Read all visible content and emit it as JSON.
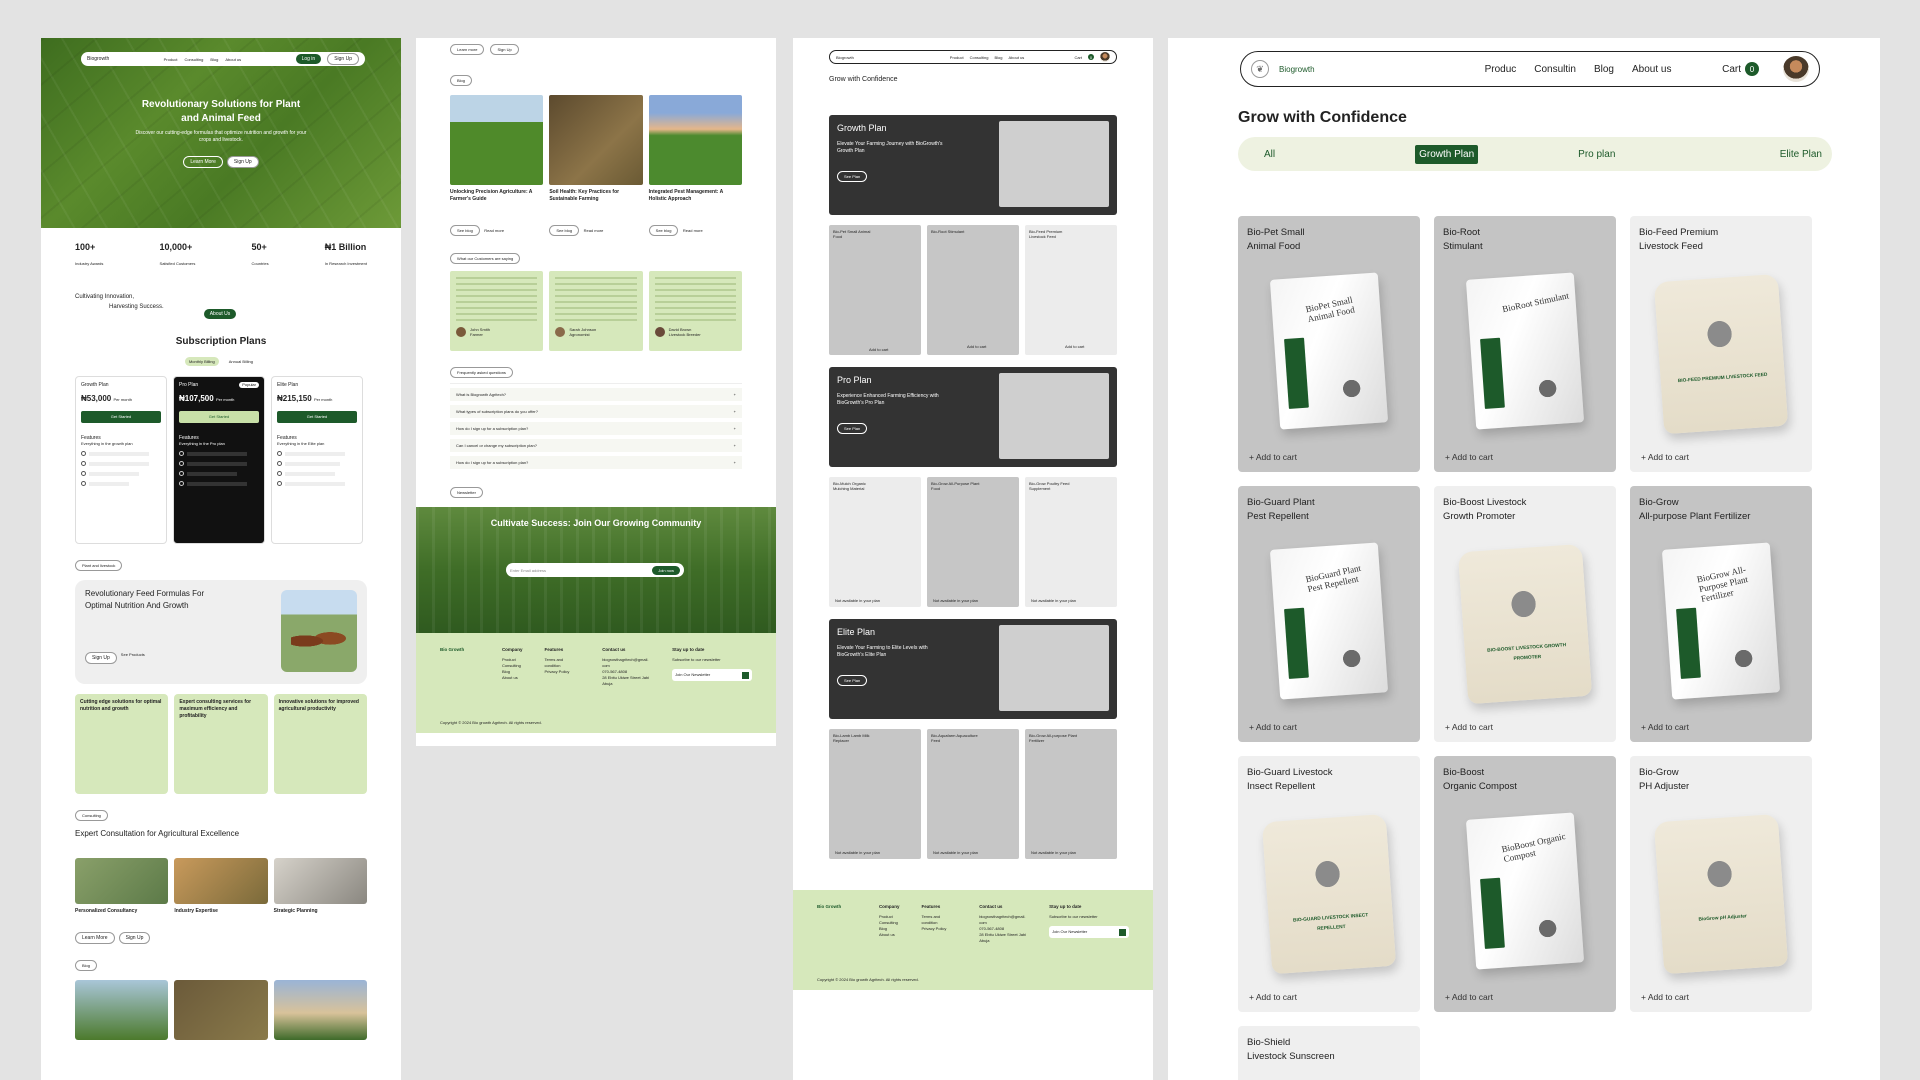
{
  "home": {
    "nav": {
      "logo": "Biogrowth",
      "links": [
        "Product",
        "Consulting",
        "Blog",
        "About us"
      ],
      "login": "Log in",
      "signup": "Sign Up"
    },
    "hero": {
      "title": "Revolutionary Solutions for Plant and Animal Feed",
      "subtitle": "Discover our cutting-edge formulas that optimize nutrition and growth for your crops and livestock.",
      "learn_more": "Learn More",
      "sign_up": "Sign Up"
    },
    "stats": [
      {
        "value": "100+",
        "label": "Industry Awards"
      },
      {
        "value": "10,000+",
        "label": "Satisfied Customers"
      },
      {
        "value": "50+",
        "label": "Countries"
      },
      {
        "value": "₦1 Billion",
        "label": "In Research Investment"
      }
    ],
    "cultivating": {
      "line1": "Cultivating Innovation,",
      "line2": "Harvesting Success.",
      "about": "About Us"
    },
    "subscription": {
      "title": "Subscription Plans",
      "toggle": [
        "Monthly Billing",
        "Annual Billing"
      ],
      "plans": [
        {
          "name": "Growth Plan",
          "price": "₦53,000",
          "period": "Per month",
          "cta": "Get Started",
          "features_title": "Features",
          "features_sub": "Everything in the growth plan"
        },
        {
          "name": "Pro Plan",
          "badge": "Popular",
          "price": "₦107,500",
          "period": "Per month",
          "cta": "Get Started",
          "features_title": "Features",
          "features_sub": "Everything in the Pro plan"
        },
        {
          "name": "Elite Plan",
          "price": "₦215,150",
          "period": "Per month",
          "cta": "Get Started",
          "features_title": "Features",
          "features_sub": "Everything in the Elite plan"
        }
      ]
    },
    "plant_tag": "Plant and livestock",
    "feed": {
      "title": "Revolutionary Feed Formulas For Optimal Nutrition And Growth",
      "signup": "Sign Up",
      "see": "See Products"
    },
    "green_cards": [
      "Cutting edge solutions for optimal nutrition and growth",
      "Expert consulting services for maximum efficiency and profitability",
      "Innovative solutions for improved agricultural productivity"
    ],
    "consulting_tag": "Consulting",
    "consult": {
      "title": "Expert Consultation for Agricultural Excellence",
      "items": [
        "Personalized Consultancy",
        "Industry Expertise",
        "Strategic Planning"
      ],
      "learn_more": "Learn More",
      "signup": "Sign Up"
    },
    "blog_tag": "Blog"
  },
  "blog": {
    "top_learn": "Learn more",
    "top_signup": "Sign Up",
    "blog_tag": "Blog",
    "posts": [
      {
        "title": "Unlocking Precision Agriculture: A Farmer's Guide",
        "see": "See blog",
        "read": "Read more"
      },
      {
        "title": "Soil Health: Key Practices for Sustainable Farming",
        "see": "See blog",
        "read": "Read more"
      },
      {
        "title": "Integrated Pest Management: A Holistic Approach",
        "see": "See blog",
        "read": "Read more"
      }
    ],
    "customers_tag": "What our Customers are saying",
    "testimonials": [
      {
        "name": "John Smith",
        "role": "Farmer"
      },
      {
        "name": "Sarah Johnson",
        "role": "Agronomist"
      },
      {
        "name": "David Brown",
        "role": "Livestock Breeder"
      }
    ],
    "faq_tag": "Frequently asked questions",
    "faqs": [
      "What is Biogrowth Agritech?",
      "What types of subscription plans do you offer?",
      "How do I sign up for a subscription plan?",
      "Can I cancel or change my subscription plan?",
      "How do I sign up for a subscription plan?"
    ],
    "newsletter_tag": "Newsletter",
    "community": {
      "title": "Cultivate Success: Join Our Growing Community",
      "placeholder": "Enter Email address",
      "join": "Join now"
    },
    "footer": {
      "logo": "Bio Growth",
      "company": {
        "title": "Company",
        "items": [
          "Product",
          "Consulting",
          "Blog",
          "About us"
        ]
      },
      "features": {
        "title": "Features",
        "items": [
          "Terms and condition",
          "Privacy Policy"
        ]
      },
      "contact": {
        "title": "Contact us",
        "items": [
          "biogrowthagritech@gmail.com",
          "070-567-4808",
          "28 Ebitu Ukiwe Street Jabi Abuja"
        ]
      },
      "stay": {
        "title": "Stay up to date",
        "sub": "Subscribe to our newsletter",
        "input": "Join Our Newsletter"
      },
      "copyright": "Copyright © 2024 Bio growth Agritech. All rights reserved."
    }
  },
  "plans_page": {
    "nav": {
      "logo": "Biogrowth",
      "links": [
        "Product",
        "Consulting",
        "Blog",
        "About us"
      ],
      "cart": "Cart",
      "cart_count": "0"
    },
    "title": "Grow with Confidence",
    "blocks": [
      {
        "name": "Growth Plan",
        "desc": "Elevate Your Farming Journey with BioGrowth's Growth Plan",
        "cta": "See Plan",
        "products": [
          {
            "name": "Bio-Pet Small Animal Food"
          },
          {
            "name": "Bio-Root Stimulant"
          },
          {
            "name": "Bio-Feed Premium Livestock Feed"
          }
        ],
        "action": "Add to cart"
      },
      {
        "name": "Pro Plan",
        "desc": "Experience Enhanced Farming Efficiency with BioGrowth's Pro Plan",
        "cta": "See Plan",
        "products": [
          {
            "name": "Bio-Mulch Organic Mulching Material"
          },
          {
            "name": "Bio-Grow All-Purpose Plant Food"
          },
          {
            "name": "Bio-Grow Poultry Feed Supplement"
          }
        ],
        "action": "Not available in your plan"
      },
      {
        "name": "Elite Plan",
        "desc": "Elevate Your Farming to Elite Levels with BioGrowth's Elite Plan",
        "cta": "See Plan",
        "products": [
          {
            "name": "Bio-Lamb Lamb Milk Replacer"
          },
          {
            "name": "Bio-Aquafarm Aquaculture Feed"
          },
          {
            "name": "Bio-Grow All-purpose Plant Fertilizer"
          }
        ],
        "action": "Not available in your plan"
      }
    ]
  },
  "shop": {
    "nav": {
      "logo": "Biogrowth",
      "links": [
        "Produc",
        "Consultin",
        "Blog",
        "About us"
      ],
      "cart": "Cart",
      "cart_count": "0"
    },
    "title": "Grow with Confidence",
    "tabs": [
      "All",
      "Growth Plan",
      "Pro plan",
      "Elite Plan"
    ],
    "products": [
      {
        "name": "Bio-Pet Small\nAnimal Food",
        "bag_text": "BioPet Small Animal Food",
        "action": "Add to cart",
        "style": "bag",
        "bg": "dark"
      },
      {
        "name": "Bio-Root\nStimulant",
        "bag_text": "BioRoot Stimulant",
        "action": "Add to cart",
        "style": "bag",
        "bg": "dark"
      },
      {
        "name": "Bio-Feed Premium\nLivestock Feed",
        "bag_text": "BIO-FEED PREMIUM LIVESTOCK FEED",
        "action": "Add to cart",
        "style": "sack",
        "bg": "light"
      },
      {
        "name": "Bio-Guard Plant\nPest Repellent",
        "bag_text": "BioGuard Plant Pest Repellent",
        "action": "Add to cart",
        "style": "bag",
        "bg": "dark"
      },
      {
        "name": "Bio-Boost Livestock\nGrowth Promoter",
        "bag_text": "BIO-BOOST LIVESTOCK GROWTH PROMOTER",
        "action": "Add to cart",
        "style": "sack",
        "bg": "light"
      },
      {
        "name": "Bio-Grow\nAll-purpose Plant Fertilizer",
        "bag_text": "BioGrow All-Purpose Plant Fertilizer",
        "action": "Add to cart",
        "style": "bag",
        "bg": "dark"
      },
      {
        "name": "Bio-Guard Livestock\nInsect Repellent",
        "bag_text": "BIO-GUARD LIVESTOCK INSECT REPELLENT",
        "action": "Add to cart",
        "style": "sack",
        "bg": "light"
      },
      {
        "name": "Bio-Boost\nOrganic Compost",
        "bag_text": "BioBoost Organic Compost",
        "action": "Add to cart",
        "style": "bag",
        "bg": "dark"
      },
      {
        "name": "Bio-Grow\nPH Adjuster",
        "bag_text": "BioGrow pH Adjuster",
        "action": "Add to cart",
        "style": "sack",
        "bg": "light"
      },
      {
        "name": "Bio-Shield\nLivestock Sunscreen",
        "bag_text": "",
        "action": "",
        "style": "none",
        "bg": "light"
      }
    ]
  }
}
